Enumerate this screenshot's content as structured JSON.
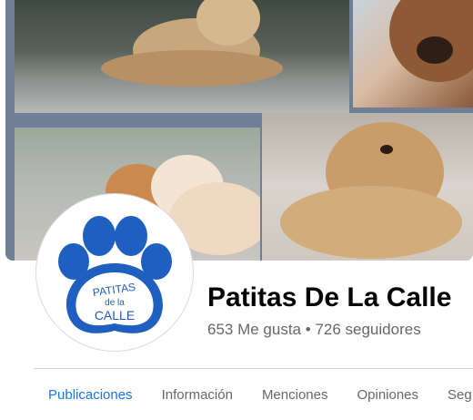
{
  "page": {
    "name": "Patitas De La Calle",
    "likes": "653 Me gusta",
    "separator": "•",
    "followers": "726 seguidores"
  },
  "logo": {
    "line1": "PATITAS",
    "line2": "de la",
    "line3": "CALLE",
    "color": "#1f5fc0"
  },
  "tabs": [
    {
      "label": "Publicaciones",
      "active": true
    },
    {
      "label": "Información"
    },
    {
      "label": "Menciones"
    },
    {
      "label": "Opiniones"
    },
    {
      "label": "Seg"
    }
  ],
  "colors": {
    "accent": "#1877f2",
    "text": "#050505",
    "secondary": "#65676b"
  }
}
